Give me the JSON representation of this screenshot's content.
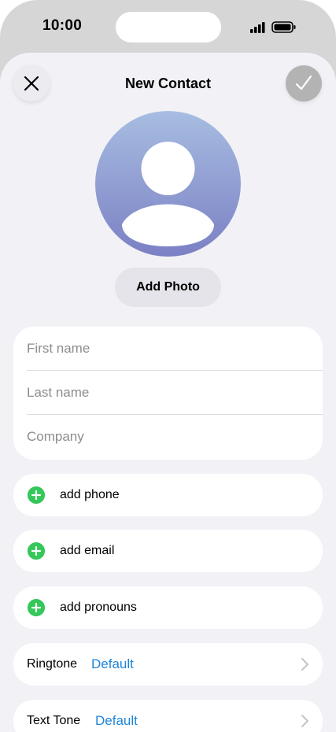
{
  "status_bar": {
    "time": "10:00"
  },
  "header": {
    "title": "New Contact"
  },
  "photo": {
    "add_label": "Add Photo"
  },
  "name_fields": [
    {
      "placeholder": "First name"
    },
    {
      "placeholder": "Last name"
    },
    {
      "placeholder": "Company"
    }
  ],
  "add_rows": [
    {
      "label": "add phone"
    },
    {
      "label": "add email"
    },
    {
      "label": "add pronouns"
    }
  ],
  "settings_rows": [
    {
      "label": "Ringtone",
      "value": "Default"
    },
    {
      "label": "Text Tone",
      "value": "Default"
    }
  ],
  "colors": {
    "accent": "#1e84d8",
    "add_green": "#34c759",
    "sheet_bg": "#f2f1f6"
  },
  "icons": {
    "close": "close-icon",
    "done": "checkmark-icon",
    "add": "plus-circle-icon",
    "chevron": "chevron-right-icon",
    "avatar": "person-silhouette-icon"
  }
}
